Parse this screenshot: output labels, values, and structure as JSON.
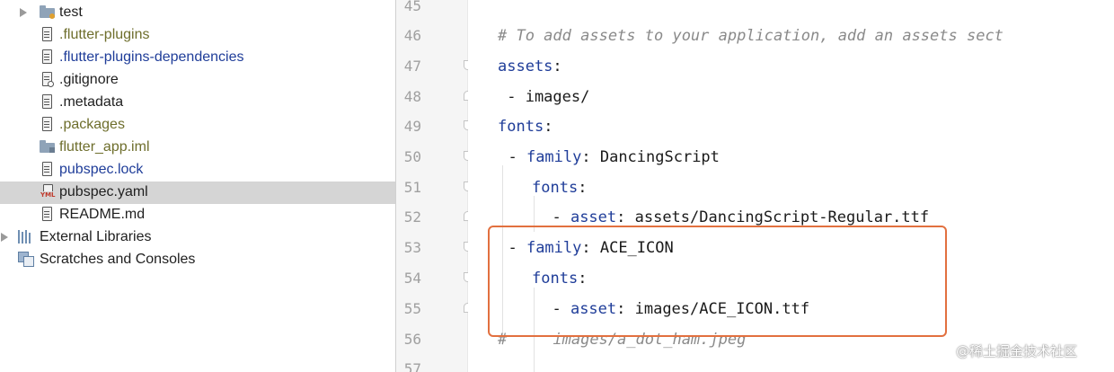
{
  "project_tree": {
    "items": [
      {
        "label": "test",
        "kind": "folder",
        "color": "dark"
      },
      {
        "label": ".flutter-plugins",
        "kind": "file",
        "color": "olive"
      },
      {
        "label": ".flutter-plugins-dependencies",
        "kind": "file",
        "color": "blue"
      },
      {
        "label": ".gitignore",
        "kind": "file-ignored",
        "color": "dark"
      },
      {
        "label": ".metadata",
        "kind": "file",
        "color": "dark"
      },
      {
        "label": ".packages",
        "kind": "file",
        "color": "olive"
      },
      {
        "label": "flutter_app.iml",
        "kind": "module",
        "color": "olive"
      },
      {
        "label": "pubspec.lock",
        "kind": "file",
        "color": "blue"
      },
      {
        "label": "pubspec.yaml",
        "kind": "yaml",
        "color": "dark",
        "selected": true
      },
      {
        "label": "README.md",
        "kind": "file",
        "color": "dark"
      },
      {
        "label": "External Libraries",
        "kind": "libraries",
        "color": "dark"
      },
      {
        "label": "Scratches and Consoles",
        "kind": "scratches",
        "color": "dark"
      }
    ]
  },
  "editor": {
    "line_numbers": [
      "45",
      "46",
      "47",
      "48",
      "49",
      "50",
      "51",
      "52",
      "53",
      "54",
      "55",
      "56",
      "57"
    ],
    "lines": {
      "l46_comment": "# To add assets to your application, add an assets sect",
      "l47_key": "assets",
      "l47_colon": ":",
      "l48_text": " - images/",
      "l49_key": "fonts",
      "l49_colon": ":",
      "l50_dash": "  - ",
      "l50_key": "family",
      "l50_value": ": DancingScript",
      "l51_key": "fonts",
      "l51_colon": ":",
      "l52_dash": "  - ",
      "l52_key": "asset",
      "l52_value": ": assets/DancingScript-Regular.ttf",
      "l53_dash": "  - ",
      "l53_key": "family",
      "l53_value": ": ACE_ICON",
      "l54_key": "fonts",
      "l54_colon": ":",
      "l55_dash": "  - ",
      "l55_key": "asset",
      "l55_value": ": images/ACE_ICON.ttf",
      "l56_comment": "#     images/a_dot_ham.jpeg"
    }
  },
  "watermark": "@稀土掘金技术社区",
  "colors": {
    "highlight_border": "#e2703f",
    "yaml_key": "#1f3d99",
    "comment": "#8a8a8a",
    "selected_row": "#d5d5d5"
  }
}
